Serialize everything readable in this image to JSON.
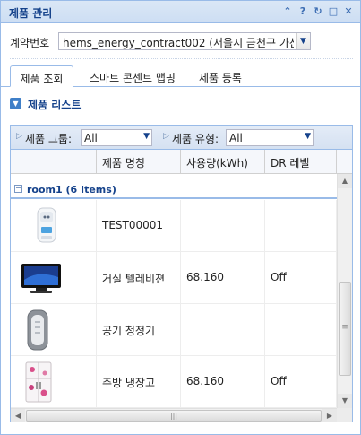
{
  "panel": {
    "title": "제품 관리",
    "tools": [
      {
        "icon": "collapse-icon",
        "glyph": "⌃"
      },
      {
        "icon": "help-icon",
        "glyph": "?"
      },
      {
        "icon": "refresh-icon",
        "glyph": "↻"
      },
      {
        "icon": "maximize-icon",
        "glyph": "□"
      },
      {
        "icon": "close-icon",
        "glyph": "✕"
      }
    ]
  },
  "contract": {
    "label": "계약번호",
    "value": "hems_energy_contract002 (서울시 금천구 가산..."
  },
  "tabs": [
    {
      "label": "제품 조회",
      "active": true
    },
    {
      "label": "스마트 콘센트 맵핑",
      "active": false
    },
    {
      "label": "제품 등록",
      "active": false
    }
  ],
  "list": {
    "title": "제품 리스트",
    "filters": {
      "group_label": "제품 그룹:",
      "group_value": "All",
      "type_label": "제품 유형:",
      "type_value": "All"
    },
    "columns": [
      "",
      "제품 명칭",
      "사용량(kWh)",
      "DR 레벨"
    ],
    "group": "room1 (6 Items)",
    "rows": [
      {
        "image": "smart-plug-image",
        "name": "TEST00001",
        "usage": "",
        "dr": ""
      },
      {
        "image": "tv-image",
        "name": "거실 텔레비젼",
        "usage": "68.160",
        "dr": "Off"
      },
      {
        "image": "air-purifier-image",
        "name": "공기 청정기",
        "usage": "",
        "dr": ""
      },
      {
        "image": "refrigerator-image",
        "name": "주방 냉장고",
        "usage": "68.160",
        "dr": "Off"
      }
    ]
  },
  "colors": {
    "accent": "#15428b",
    "border": "#99bbe8",
    "header_bg": "#dae7f6"
  }
}
